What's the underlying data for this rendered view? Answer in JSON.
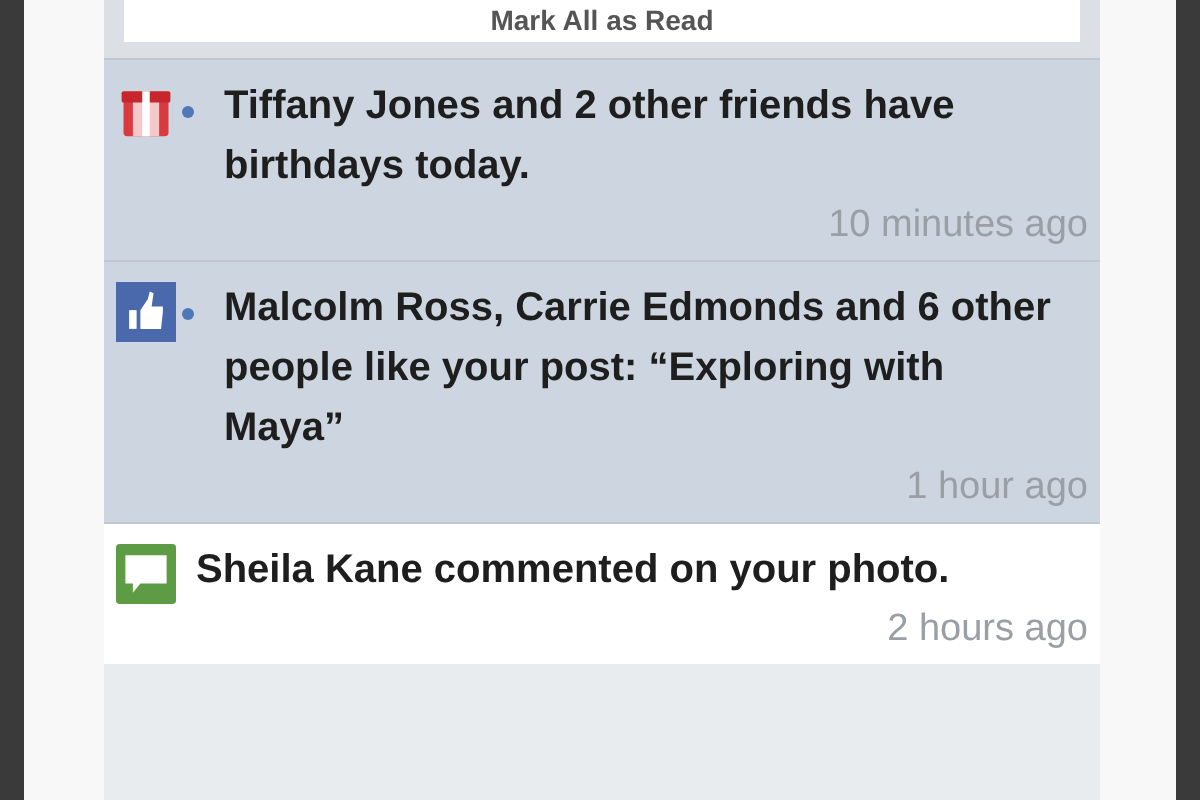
{
  "mark_all_button": {
    "label": "Mark All as Read"
  },
  "notifications": [
    {
      "kind": "birthday",
      "unread": true,
      "text": "Tiffany Jones and 2 other friends have birthdays today.",
      "time": "10 minutes ago"
    },
    {
      "kind": "like",
      "unread": true,
      "text": "Malcolm Ross, Carrie Edmonds and 6 other people like your post: “Exploring with Maya”",
      "time": "1 hour ago"
    },
    {
      "kind": "comment",
      "unread": false,
      "text": "Sheila Kane commented on your photo.",
      "time": "2 hours ago"
    }
  ]
}
